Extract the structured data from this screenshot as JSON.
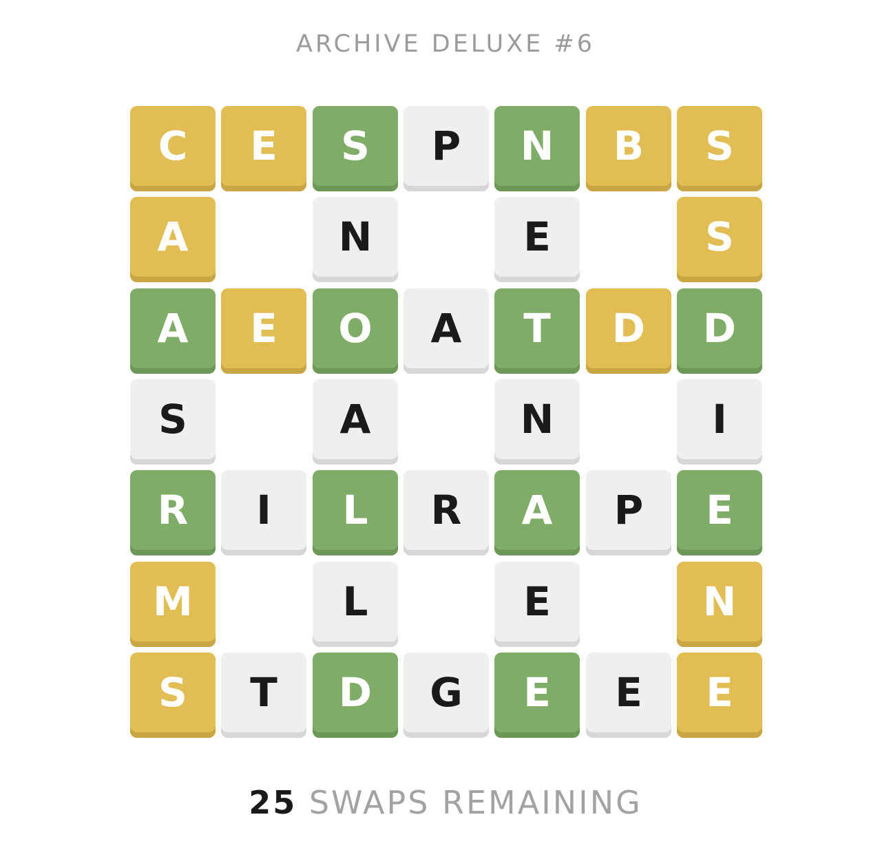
{
  "header": {
    "title": "ARCHIVE DELUXE #6"
  },
  "colors": {
    "green": "#7fac67",
    "yellow": "#e1bd53",
    "gray": "#eeeff1"
  },
  "board": {
    "rows": [
      [
        {
          "letter": "C",
          "state": "yellow"
        },
        {
          "letter": "E",
          "state": "yellow"
        },
        {
          "letter": "S",
          "state": "green"
        },
        {
          "letter": "P",
          "state": "gray"
        },
        {
          "letter": "N",
          "state": "green"
        },
        {
          "letter": "B",
          "state": "yellow"
        },
        {
          "letter": "S",
          "state": "yellow"
        }
      ],
      [
        {
          "letter": "A",
          "state": "yellow"
        },
        null,
        {
          "letter": "N",
          "state": "gray"
        },
        null,
        {
          "letter": "E",
          "state": "gray"
        },
        null,
        {
          "letter": "S",
          "state": "yellow"
        }
      ],
      [
        {
          "letter": "A",
          "state": "green"
        },
        {
          "letter": "E",
          "state": "yellow"
        },
        {
          "letter": "O",
          "state": "green"
        },
        {
          "letter": "A",
          "state": "gray"
        },
        {
          "letter": "T",
          "state": "green"
        },
        {
          "letter": "D",
          "state": "yellow"
        },
        {
          "letter": "D",
          "state": "green"
        }
      ],
      [
        {
          "letter": "S",
          "state": "gray"
        },
        null,
        {
          "letter": "A",
          "state": "gray"
        },
        null,
        {
          "letter": "N",
          "state": "gray"
        },
        null,
        {
          "letter": "I",
          "state": "gray"
        }
      ],
      [
        {
          "letter": "R",
          "state": "green"
        },
        {
          "letter": "I",
          "state": "gray"
        },
        {
          "letter": "L",
          "state": "green"
        },
        {
          "letter": "R",
          "state": "gray"
        },
        {
          "letter": "A",
          "state": "green"
        },
        {
          "letter": "P",
          "state": "gray"
        },
        {
          "letter": "E",
          "state": "green"
        }
      ],
      [
        {
          "letter": "M",
          "state": "yellow"
        },
        null,
        {
          "letter": "L",
          "state": "gray"
        },
        null,
        {
          "letter": "E",
          "state": "gray"
        },
        null,
        {
          "letter": "N",
          "state": "yellow"
        }
      ],
      [
        {
          "letter": "S",
          "state": "yellow"
        },
        {
          "letter": "T",
          "state": "gray"
        },
        {
          "letter": "D",
          "state": "green"
        },
        {
          "letter": "G",
          "state": "gray"
        },
        {
          "letter": "E",
          "state": "green"
        },
        {
          "letter": "E",
          "state": "gray"
        },
        {
          "letter": "E",
          "state": "yellow"
        }
      ]
    ]
  },
  "footer": {
    "swaps_count": "25",
    "swaps_label": "SWAPS REMAINING"
  }
}
